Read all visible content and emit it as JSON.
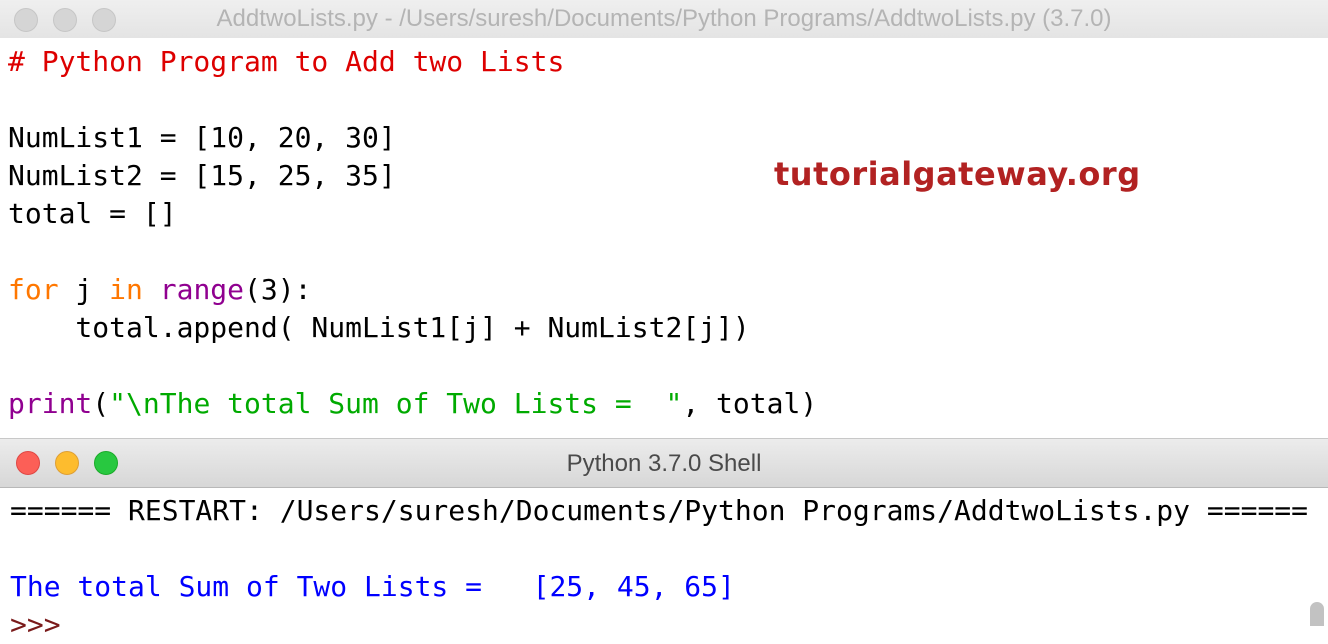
{
  "editor_window": {
    "title": "AddtwoLists.py - /Users/suresh/Documents/Python Programs/AddtwoLists.py (3.7.0)"
  },
  "code": {
    "comment": "# Python Program to Add two Lists",
    "line_numlist1": "NumList1 = [10, 20, 30]",
    "line_numlist2": "NumList2 = [15, 25, 35]",
    "line_total": "total = []",
    "for_kw": "for",
    "for_var": " j ",
    "in_kw": "in",
    "range_fn": "range",
    "range_args": "(3):",
    "append_line": "    total.append( NumList1[j] + NumList2[j])",
    "print_fn": "print",
    "print_open": "(",
    "print_string": "\"\\nThe total Sum of Two Lists =  \"",
    "print_rest": ", total)"
  },
  "watermark": "tutorialgateway.org",
  "shell_window": {
    "title": "Python 3.7.0 Shell",
    "restart_line": "====== RESTART: /Users/suresh/Documents/Python Programs/AddtwoLists.py ======",
    "output_line": "The total Sum of Two Lists =   [25, 45, 65]",
    "prompt": ">>>"
  },
  "colors": {
    "comment": "#dd0000",
    "keyword": "#ff7700",
    "builtin": "#900090",
    "string": "#00aa00",
    "output": "#0000ff",
    "watermark": "#b22222"
  }
}
